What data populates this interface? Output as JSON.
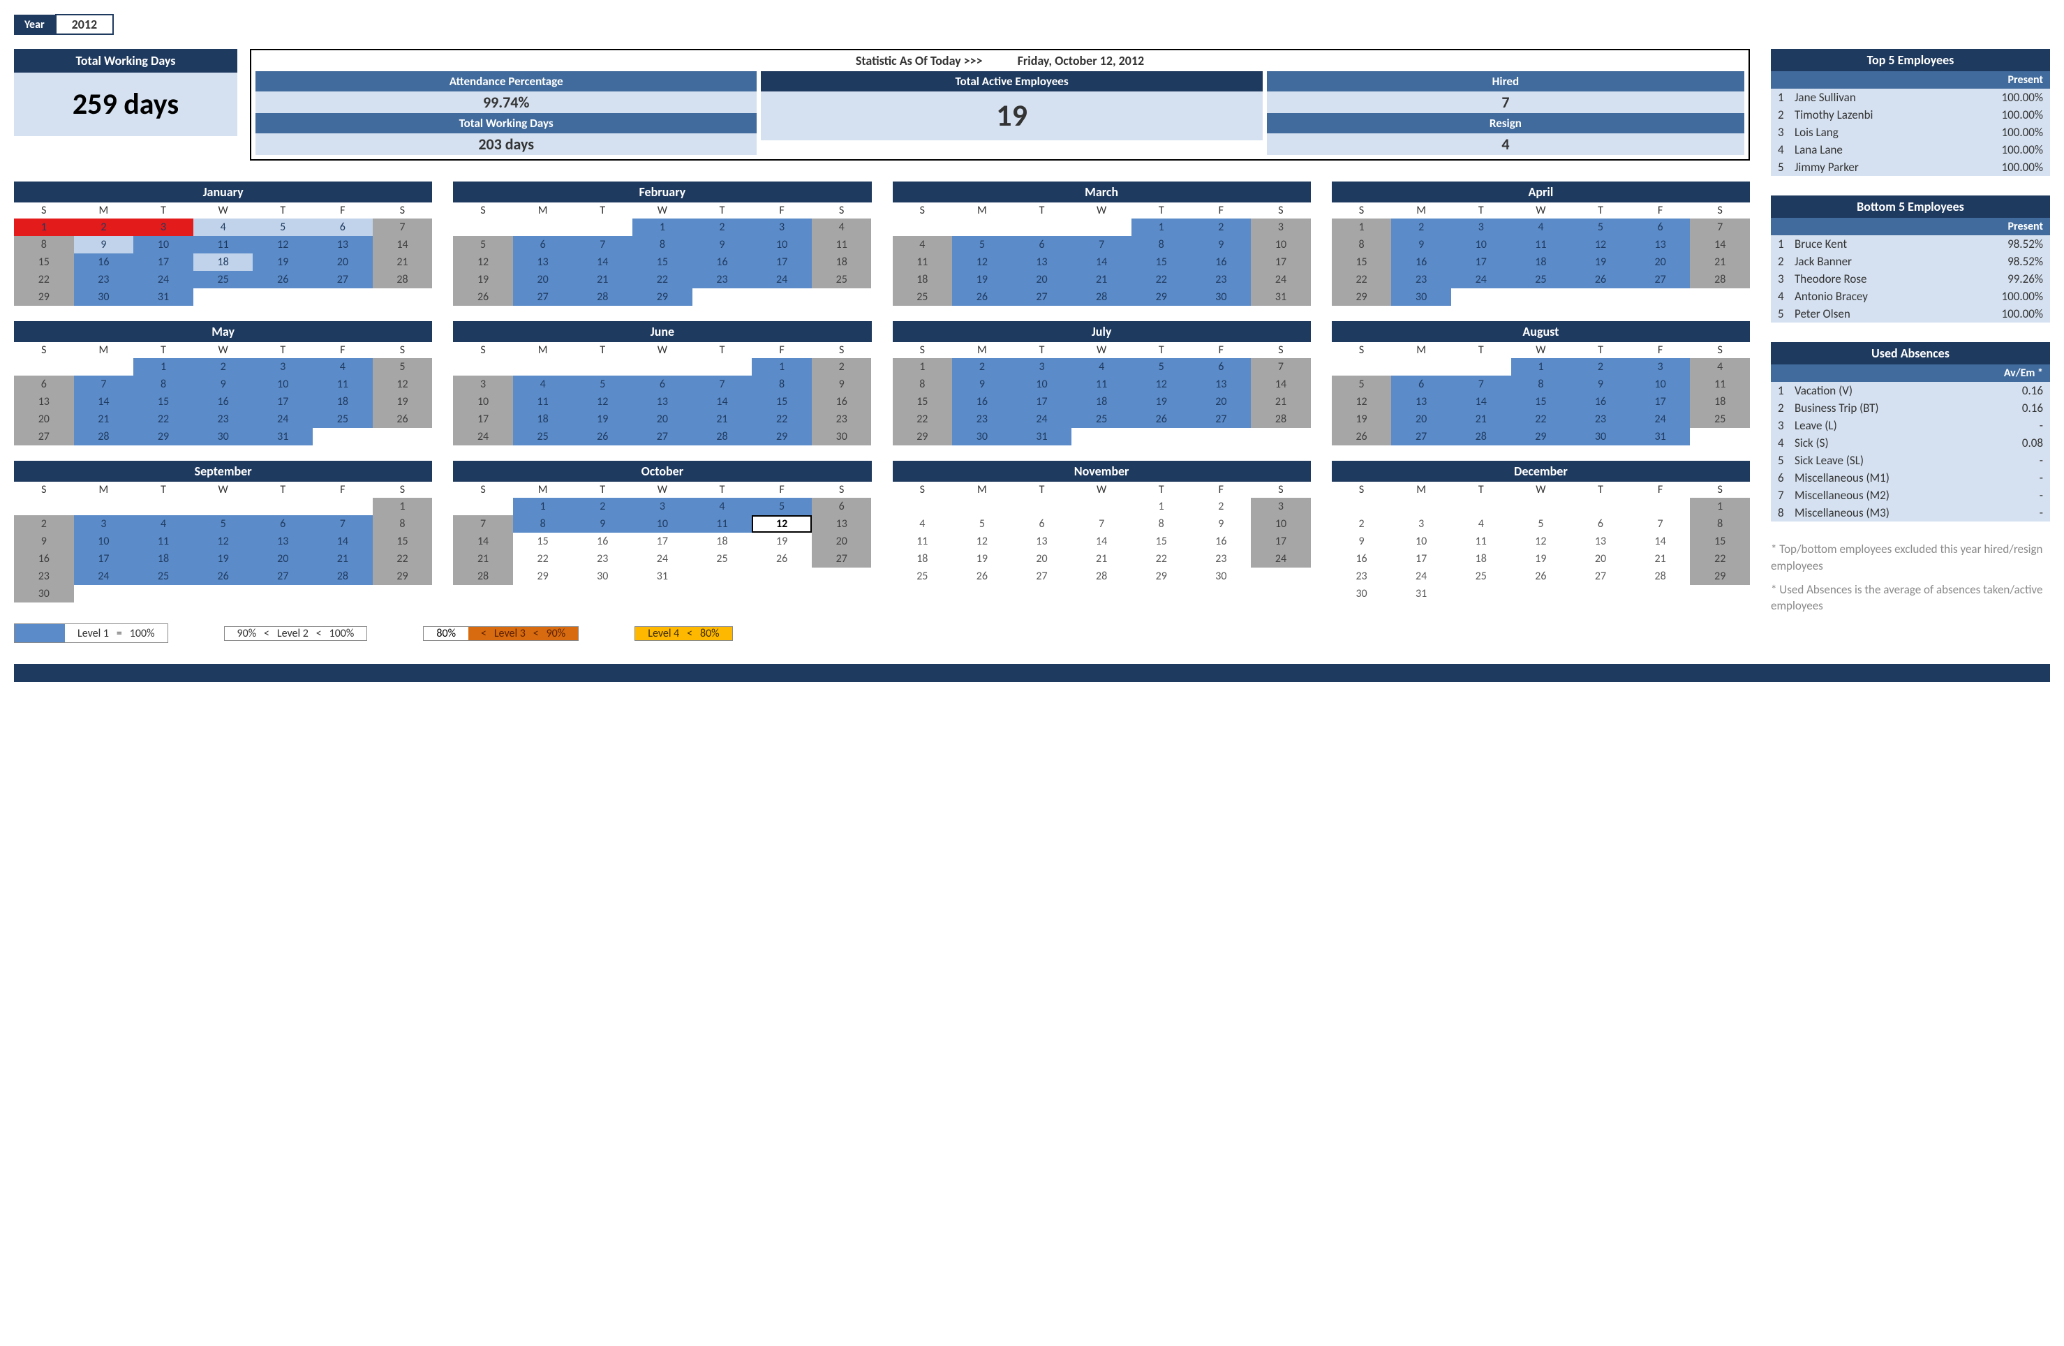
{
  "year": {
    "label": "Year",
    "value": "2012"
  },
  "twd": {
    "title": "Total Working Days",
    "value": "259 days"
  },
  "stats": {
    "asof_label": "Statistic As Of Today   >>>",
    "asof_date": "Friday, October 12, 2012",
    "att_pct_label": "Attendance Percentage",
    "att_pct": "99.74%",
    "twd_label": "Total Working Days",
    "twd": "203 days",
    "active_label": "Total Active Employees",
    "active": "19",
    "hired_label": "Hired",
    "hired": "7",
    "resign_label": "Resign",
    "resign": "4"
  },
  "dow": [
    "S",
    "M",
    "T",
    "W",
    "T",
    "F",
    "S"
  ],
  "months": [
    {
      "name": "January",
      "lead": 0,
      "days": 31,
      "today": 0,
      "style": {
        "1": "red",
        "2": "red",
        "3": "red",
        "4": "l2",
        "5": "l2",
        "6": "l2",
        "9": "l2",
        "18": "l2"
      }
    },
    {
      "name": "February",
      "lead": 3,
      "days": 29,
      "today": 0,
      "style": {}
    },
    {
      "name": "March",
      "lead": 4,
      "days": 31,
      "today": 0,
      "style": {}
    },
    {
      "name": "April",
      "lead": 0,
      "days": 30,
      "today": 0,
      "style": {}
    },
    {
      "name": "May",
      "lead": 2,
      "days": 31,
      "today": 0,
      "style": {}
    },
    {
      "name": "June",
      "lead": 5,
      "days": 30,
      "today": 0,
      "style": {}
    },
    {
      "name": "July",
      "lead": 0,
      "days": 31,
      "today": 0,
      "style": {}
    },
    {
      "name": "August",
      "lead": 3,
      "days": 31,
      "today": 0,
      "style": {}
    },
    {
      "name": "September",
      "lead": 6,
      "days": 30,
      "today": 0,
      "style": {}
    },
    {
      "name": "October",
      "lead": 1,
      "days": 31,
      "today": 12,
      "plain_after": 12,
      "style": {}
    },
    {
      "name": "November",
      "lead": 4,
      "days": 30,
      "today": 0,
      "all_plain": true,
      "wk_plain": [
        3,
        10,
        17,
        24
      ],
      "style": {}
    },
    {
      "name": "December",
      "lead": 6,
      "days": 31,
      "today": 0,
      "all_plain": true,
      "wk_plain": [
        1,
        8,
        15,
        22,
        29
      ],
      "style": {}
    }
  ],
  "legend": {
    "l1": {
      "label": "Level 1",
      "eq": "=",
      "val": "100%"
    },
    "l2": {
      "pre": "90%",
      "lt1": "<",
      "label": "Level 2",
      "lt2": "<",
      "val": "100%"
    },
    "l3": {
      "pre": "80%",
      "lt1": "<",
      "label": "Level 3",
      "lt2": "<",
      "val": "90%"
    },
    "l4": {
      "label": "Level 4",
      "lt": "<",
      "val": "80%"
    }
  },
  "top5": {
    "title": "Top 5 Employees",
    "col": "Present",
    "rows": [
      {
        "n": "1",
        "name": "Jane Sullivan",
        "val": "100.00%"
      },
      {
        "n": "2",
        "name": "Timothy Lazenbi",
        "val": "100.00%"
      },
      {
        "n": "3",
        "name": "Lois Lang",
        "val": "100.00%"
      },
      {
        "n": "4",
        "name": "Lana Lane",
        "val": "100.00%"
      },
      {
        "n": "5",
        "name": "Jimmy Parker",
        "val": "100.00%"
      }
    ]
  },
  "bot5": {
    "title": "Bottom 5 Employees",
    "col": "Present",
    "rows": [
      {
        "n": "1",
        "name": "Bruce Kent",
        "val": "98.52%"
      },
      {
        "n": "2",
        "name": "Jack Banner",
        "val": "98.52%"
      },
      {
        "n": "3",
        "name": "Theodore Rose",
        "val": "99.26%"
      },
      {
        "n": "4",
        "name": "Antonio Bracey",
        "val": "100.00%"
      },
      {
        "n": "5",
        "name": "Peter Olsen",
        "val": "100.00%"
      }
    ]
  },
  "absences": {
    "title": "Used Absences",
    "col": "Av/Em *",
    "rows": [
      {
        "n": "1",
        "name": "Vacation (V)",
        "val": "0.16"
      },
      {
        "n": "2",
        "name": "Business Trip (BT)",
        "val": "0.16"
      },
      {
        "n": "3",
        "name": "Leave (L)",
        "val": "-"
      },
      {
        "n": "4",
        "name": "Sick (S)",
        "val": "0.08"
      },
      {
        "n": "5",
        "name": "Sick Leave (SL)",
        "val": "-"
      },
      {
        "n": "6",
        "name": "Miscellaneous (M1)",
        "val": "-"
      },
      {
        "n": "7",
        "name": "Miscellaneous (M2)",
        "val": "-"
      },
      {
        "n": "8",
        "name": "Miscellaneous (M3)",
        "val": "-"
      }
    ]
  },
  "footnote1": "* Top/bottom employees excluded this year hired/resign employees",
  "footnote2": "* Used Absences is the average of absences taken/active employees"
}
